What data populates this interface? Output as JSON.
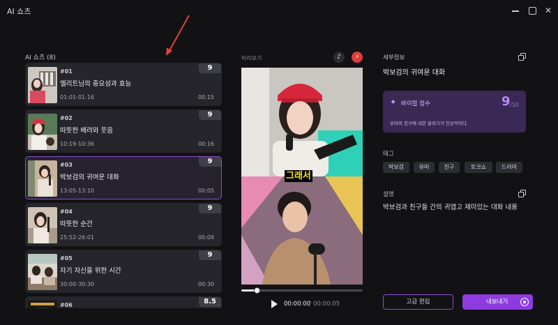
{
  "app": {
    "title": "AI 쇼츠",
    "close_glyph": "✕"
  },
  "list": {
    "header": "AI 쇼츠 (8)",
    "clips": [
      {
        "num": "#01",
        "title": "엘리트님의 중요성과 효능",
        "range": "01:01-01:16",
        "duration": "00:15",
        "score": "9"
      },
      {
        "num": "#02",
        "title": "따뜻한 배려와 웃음",
        "range": "10:19-10:36",
        "duration": "00:16",
        "score": "9"
      },
      {
        "num": "#03",
        "title": "박보검의 귀여운 대화",
        "range": "13:05-13:10",
        "duration": "00:05",
        "score": "9"
      },
      {
        "num": "#04",
        "title": "따뜻한 순간",
        "range": "25:52-26:01",
        "duration": "00:09",
        "score": "9"
      },
      {
        "num": "#05",
        "title": "자기 자신을 위한 시간",
        "range": "30:00-30:30",
        "duration": "00:30",
        "score": "9"
      },
      {
        "num": "#06",
        "title": "",
        "range": "",
        "duration": "",
        "score": "8.5"
      }
    ]
  },
  "preview": {
    "label": "미리보기",
    "tiktok_glyph": "♪",
    "flash_glyph": "⚡",
    "subtitle": "그래서",
    "progress_fraction": 0.13,
    "time_current": "00:00:00",
    "time_sep": "/",
    "time_total": "00:00:05"
  },
  "details": {
    "section_label": "세부정보",
    "title": "박보검의 귀여운 대화",
    "viral_icon": "✦",
    "viral_label": "바이럴 점수",
    "viral_score": "9",
    "viral_max": "/10",
    "viral_desc": "유머와 친구에 대한 분위기가 인상적이다.",
    "tags_label": "태그",
    "tags": [
      "박보검",
      "유머",
      "친구",
      "토크쇼",
      "드라마"
    ],
    "desc_label": "설명",
    "description": "박보검과 친구들 간의 귀엽고 재미있는 대화 내용"
  },
  "actions": {
    "advanced_edit": "고급 편집",
    "export": "내보내기"
  },
  "colors": {
    "accent": "#8e3be0",
    "selected_border": "#8c4dd6",
    "viral_bg": "#3a2855",
    "subtitle": "#f6e72a"
  }
}
